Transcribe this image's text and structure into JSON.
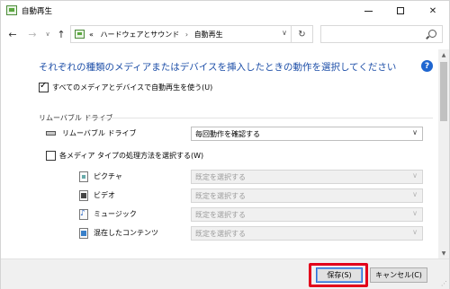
{
  "window": {
    "title": "自動再生",
    "icon": "autoplay-icon"
  },
  "nav": {
    "back": "←",
    "forward": "→",
    "recent": "∨",
    "up": "↑",
    "breadcrumb_prefix": "«",
    "breadcrumb": [
      "ハードウェアとサウンド",
      "自動再生"
    ],
    "breadcrumb_sep": "›",
    "refresh": "↻",
    "search_placeholder": ""
  },
  "content": {
    "heading": "それぞれの種類のメディアまたはデバイスを挿入したときの動作を選択してください",
    "help": "?",
    "use_autoplay_label": "すべてのメディアとデバイスで自動再生を使う(U)",
    "use_autoplay_checked": true,
    "removable_section_title": "リムーバブル ドライブ",
    "removable_drive_label": "リムーバブル ドライブ",
    "removable_drive_value": "毎回動作を確認する",
    "per_media_label": "各メディア タイプの処理方法を選択する(W)",
    "per_media_checked": false,
    "media_items": [
      {
        "label": "ピクチャ",
        "value": "既定を選択する",
        "icon": "picture-icon"
      },
      {
        "label": "ビデオ",
        "value": "既定を選択する",
        "icon": "video-icon"
      },
      {
        "label": "ミュージック",
        "value": "既定を選択する",
        "icon": "music-icon"
      },
      {
        "label": "混在したコンテンツ",
        "value": "既定を選択する",
        "icon": "mixed-content-icon"
      }
    ]
  },
  "footer": {
    "save_label": "保存(S)",
    "cancel_label": "キャンセル(C)"
  },
  "colors": {
    "heading": "#1e4fa8",
    "highlight": "#e3001b",
    "help": "#1f66d0"
  }
}
